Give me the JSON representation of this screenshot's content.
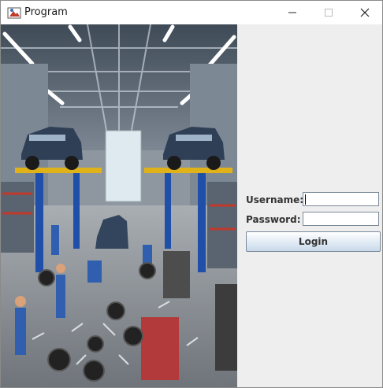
{
  "window": {
    "title": "Program",
    "controls": [
      "minimize-icon",
      "maximize-icon",
      "close-icon"
    ]
  },
  "image": {
    "description_icon": "garage-scene-image"
  },
  "form": {
    "username_label": "Username:",
    "username_value": "",
    "password_label": "Password:",
    "password_value": "",
    "login_label": "Login"
  },
  "colors": {
    "titlebar": "#ffffff",
    "panel": "#eeeeee",
    "button_top": "#ffffff",
    "button_bottom": "#c9d9ea",
    "field_border": "#7a8a99"
  }
}
